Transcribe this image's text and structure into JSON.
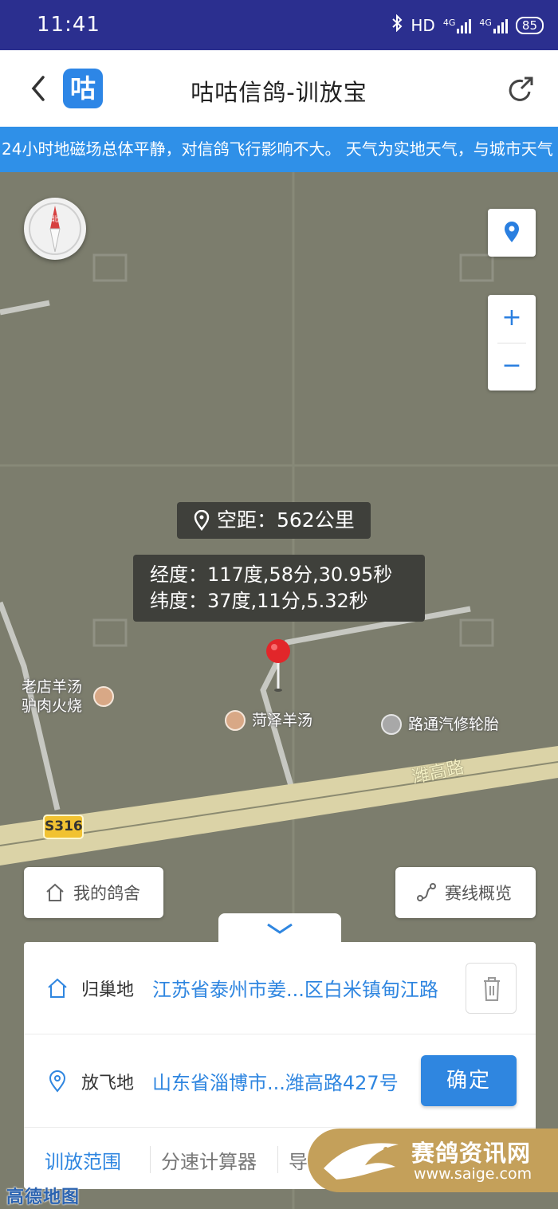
{
  "status_bar": {
    "time": "11:41",
    "network": "HD",
    "signal1": "4G",
    "signal2": "4G",
    "battery": "85"
  },
  "header": {
    "title": "咕咕信鸽-训放宝",
    "logo_char": "咕"
  },
  "ticker": {
    "text": "24小时地磁场总体平静，对信鸽飞行影响不大。 天气为实地天气，与城市天气"
  },
  "map": {
    "distance_label": "空距：562公里",
    "longitude": "经度：117度,58分,30.95秒",
    "latitude": "纬度：37度,11分,5.32秒",
    "compass_char": "北",
    "zoom_in": "+",
    "zoom_out": "−",
    "pois": [
      {
        "name_line1": "老店羊汤",
        "name_line2": "驴肉火烧"
      },
      {
        "name": "菏泽羊汤"
      },
      {
        "name": "路通汽修轮胎"
      }
    ],
    "road_name": "潍高路",
    "route_shield": "S316",
    "provider": "高德地图"
  },
  "chips": {
    "my_loft": "我的鸽舍",
    "route_overview": "赛线概览"
  },
  "panel": {
    "home": {
      "label": "归巢地",
      "value": "江苏省泰州市姜...区白米镇甸江路"
    },
    "release": {
      "label": "放飞地",
      "value": "山东省淄博市...潍高路427号"
    },
    "confirm": "确定",
    "tabs": [
      "训放范围",
      "分速计算器",
      "导"
    ]
  },
  "watermark": {
    "title": "赛鸽资讯网",
    "url": "www.saige.com"
  },
  "colors": {
    "accent": "#2f86e0",
    "status_bar": "#2b2f8f",
    "map_bg": "#7c7d6d"
  }
}
